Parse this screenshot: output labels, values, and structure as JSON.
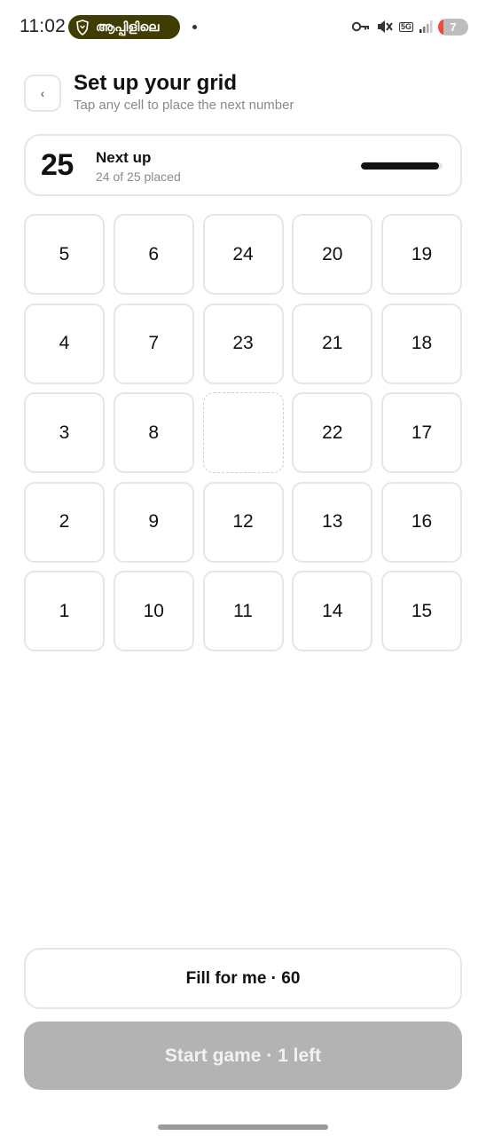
{
  "status_bar": {
    "time": "11:02",
    "app_label": "ആപ്പിളിലെ",
    "network": "5G",
    "battery": "7",
    "icons": [
      "key-icon",
      "mute-icon",
      "network-5g-icon",
      "signal-icon",
      "battery-icon"
    ]
  },
  "header": {
    "back_label": "‹",
    "title": "Set up your grid",
    "subtitle": "Tap any cell to place the next number"
  },
  "next_card": {
    "number": "25",
    "label": "Next up",
    "count_text": "24 of 25 placed",
    "progress": 0.96
  },
  "grid": {
    "rows": 5,
    "columns": 5,
    "cells": [
      "5",
      "6",
      "24",
      "20",
      "19",
      "4",
      "7",
      "23",
      "21",
      "18",
      "3",
      "8",
      "",
      "22",
      "17",
      "2",
      "9",
      "12",
      "13",
      "16",
      "1",
      "10",
      "11",
      "14",
      "15"
    ]
  },
  "actions": {
    "fill_label": "Fill for me · 60",
    "start_label": "Start game · 1 left"
  },
  "colors": {
    "accent": "#111111",
    "card_border": "#e6e6e6",
    "muted_text": "#8a8a8a",
    "disabled_button": "#b3b3b3",
    "app_pill": "#3f3d04",
    "battery_low": "#e94b3c"
  }
}
